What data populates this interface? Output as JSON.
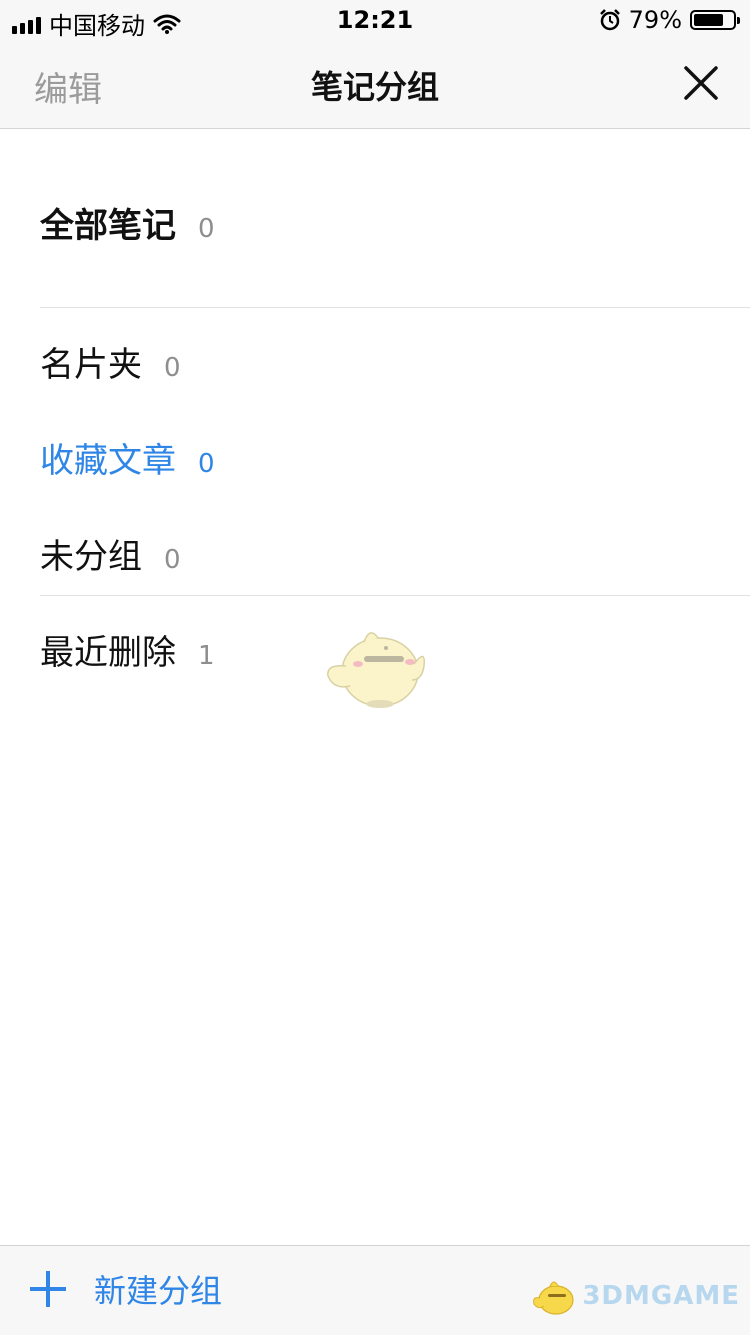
{
  "status_bar": {
    "carrier": "中国移动",
    "time": "12:21",
    "battery_percent": "79%",
    "battery_level": 0.79
  },
  "nav": {
    "edit_label": "编辑",
    "title": "笔记分组"
  },
  "groups": [
    {
      "label": "全部笔记",
      "count": "0"
    },
    {
      "label": "名片夹",
      "count": "0"
    },
    {
      "label": "收藏文章",
      "count": "0"
    },
    {
      "label": "未分组",
      "count": "0"
    },
    {
      "label": "最近删除",
      "count": "1"
    }
  ],
  "bottom": {
    "add_label": "新建分组"
  },
  "watermark": {
    "logo_text": "3DMGAME"
  },
  "colors": {
    "accent": "#2f86e6",
    "muted_text": "#9b9b9b",
    "bar_background": "#f7f7f7"
  }
}
